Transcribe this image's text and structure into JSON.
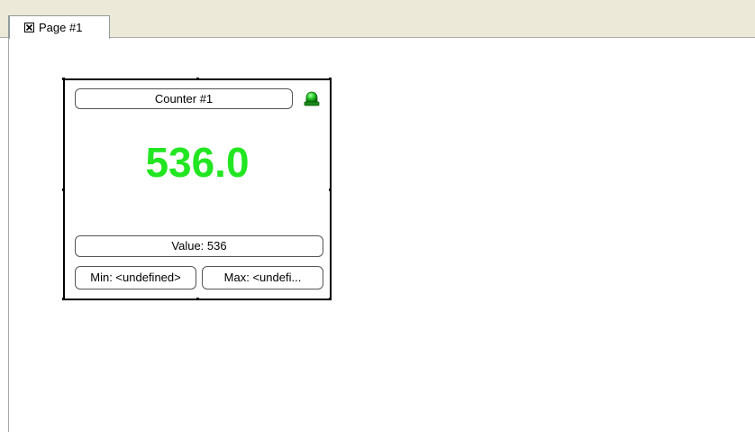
{
  "tabs": [
    {
      "label": "Page #1"
    }
  ],
  "widget": {
    "title": "Counter #1",
    "display_value": "536.0",
    "value_label": "Value: 536",
    "min_label": "Min: <undefined>",
    "max_label": "Max: <undefi...",
    "value_color": "#22e622",
    "led_color": "#1fae1f",
    "led_icon": "status-led-icon"
  },
  "colors": {
    "chrome": "#ece9d8",
    "border": "#000000"
  }
}
